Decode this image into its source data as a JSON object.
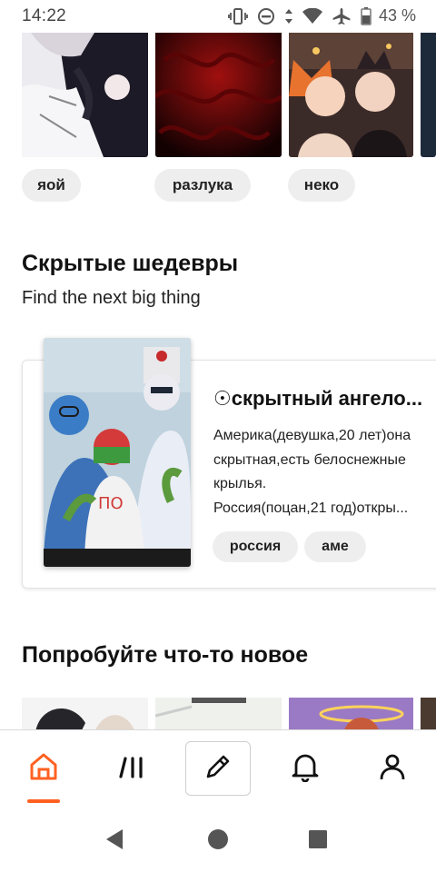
{
  "status_bar": {
    "time": "14:22",
    "battery": "43 %",
    "icons": [
      "vibrate-icon",
      "dnd-icon",
      "data-arrows-icon",
      "wifi-icon",
      "airplane-icon",
      "battery-icon"
    ]
  },
  "tag_carousel": {
    "chips": [
      "яой",
      "разлука",
      "неко"
    ]
  },
  "hidden_gems": {
    "title": "Скрытые шедевры",
    "subtitle": "Find the next big thing",
    "story": {
      "title": "☉скрытный ангело...",
      "description_lines": [
        "Америка(девушка,20 лет)она",
        "скрытная,есть белоснежные",
        "крылья.",
        "Россия(поцан,21 год)откры..."
      ],
      "tags": [
        "россия",
        "аме"
      ]
    }
  },
  "try_new": {
    "title": "Попробуйте что-то новое"
  },
  "bottom_nav": {
    "items": [
      "home-icon",
      "library-icon",
      "write-icon",
      "notifications-icon",
      "profile-icon"
    ],
    "active": "home",
    "accent": "#ff6122"
  },
  "system_nav": [
    "back-icon",
    "home-circle-icon",
    "recents-icon"
  ]
}
